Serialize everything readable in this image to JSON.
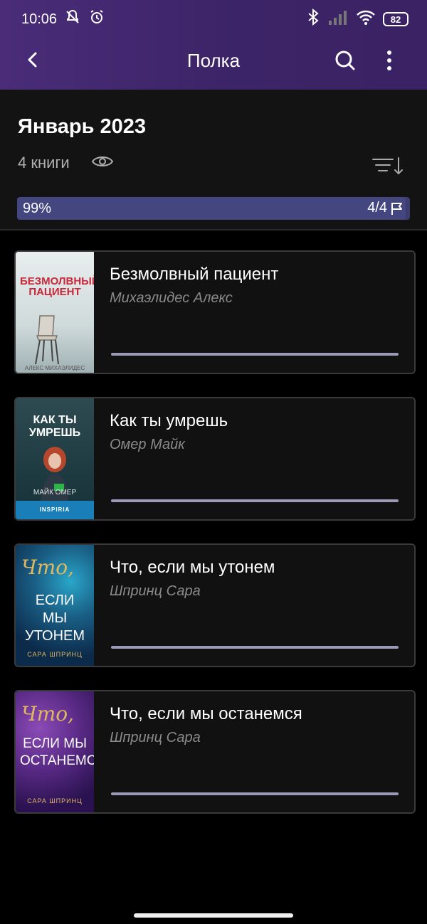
{
  "status_bar": {
    "time": "10:06",
    "battery": "82"
  },
  "app_bar": {
    "title": "Полка"
  },
  "shelf": {
    "title": "Январь 2023",
    "count_label": "4 книги",
    "progress_percent": "99%",
    "progress_fraction": "4/4",
    "progress_value": 0.99
  },
  "books": [
    {
      "title": "Безмолвный пациент",
      "author": "Михаэлидес Алекс",
      "cover_text": "БЕЗМОЛВНЫЙ ПАЦИЕНТ",
      "cover_author": "АЛЕКС МИХАЭЛИДЕС"
    },
    {
      "title": "Как ты умрешь",
      "author": "Омер Майк",
      "cover_text": "КАК ТЫ УМРЕШЬ",
      "cover_author": "МАЙК ОМЕР",
      "cover_publisher": "INSPIRIA"
    },
    {
      "title": "Что, если мы утонем",
      "author": "Шпринц Сара",
      "cover_text_script": "Что,",
      "cover_text": "ЕСЛИ МЫ УТОНЕМ",
      "cover_author": "САРА ШПРИНЦ"
    },
    {
      "title": "Что, если мы останемся",
      "author": "Шпринц Сара",
      "cover_text_script": "Что,",
      "cover_text": "ЕСЛИ МЫ ОСТАНЕМСЯ",
      "cover_author": "САРА ШПРИНЦ"
    }
  ],
  "colors": {
    "app_bar": "#3c2468",
    "progress_bar": "#444680",
    "book_progress": "#9a9ab8"
  },
  "icons": [
    "back-arrow-icon",
    "search-icon",
    "more-vert-icon",
    "eye-icon",
    "sort-icon",
    "flag-icon"
  ]
}
